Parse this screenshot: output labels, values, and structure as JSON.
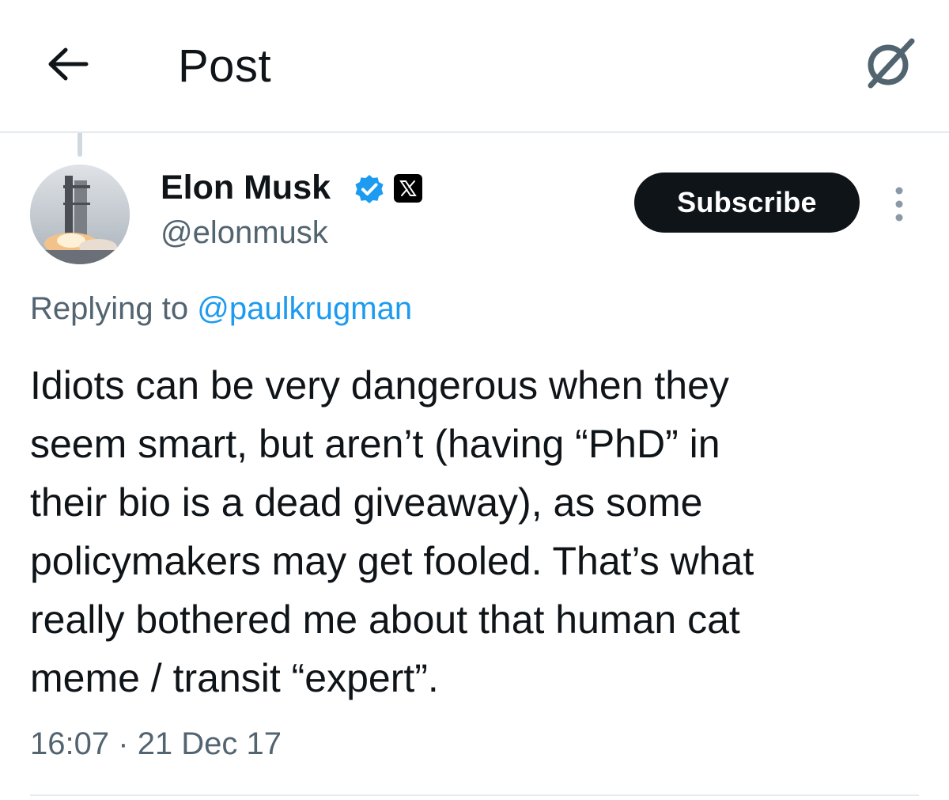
{
  "header": {
    "title": "Post",
    "back_icon": "arrow-left-icon",
    "grok_icon": "grok-icon"
  },
  "author": {
    "display_name": "Elon Musk",
    "handle": "@elonmusk",
    "verified_icon": "verified-badge-icon",
    "affiliate_icon": "x-logo-icon",
    "verified_color": "#1d9bf0"
  },
  "actions": {
    "subscribe_label": "Subscribe",
    "more_icon": "more-vertical-icon"
  },
  "reply": {
    "prefix": "Replying to ",
    "handle": "@paulkrugman"
  },
  "post": {
    "text": "Idiots can be very dangerous when they\nseem smart, but aren’t (having “PhD” in\ntheir bio is a dead giveaway), as some\npolicymakers may get fooled. That’s what\nreally bothered me about that human cat\nmeme / transit “expert”.",
    "time": "16:07",
    "separator": "·",
    "date": "21 Dec 17"
  },
  "colors": {
    "text_primary": "#0f1419",
    "text_secondary": "#536471",
    "accent": "#1d9bf0",
    "divider": "#e6ebef"
  }
}
